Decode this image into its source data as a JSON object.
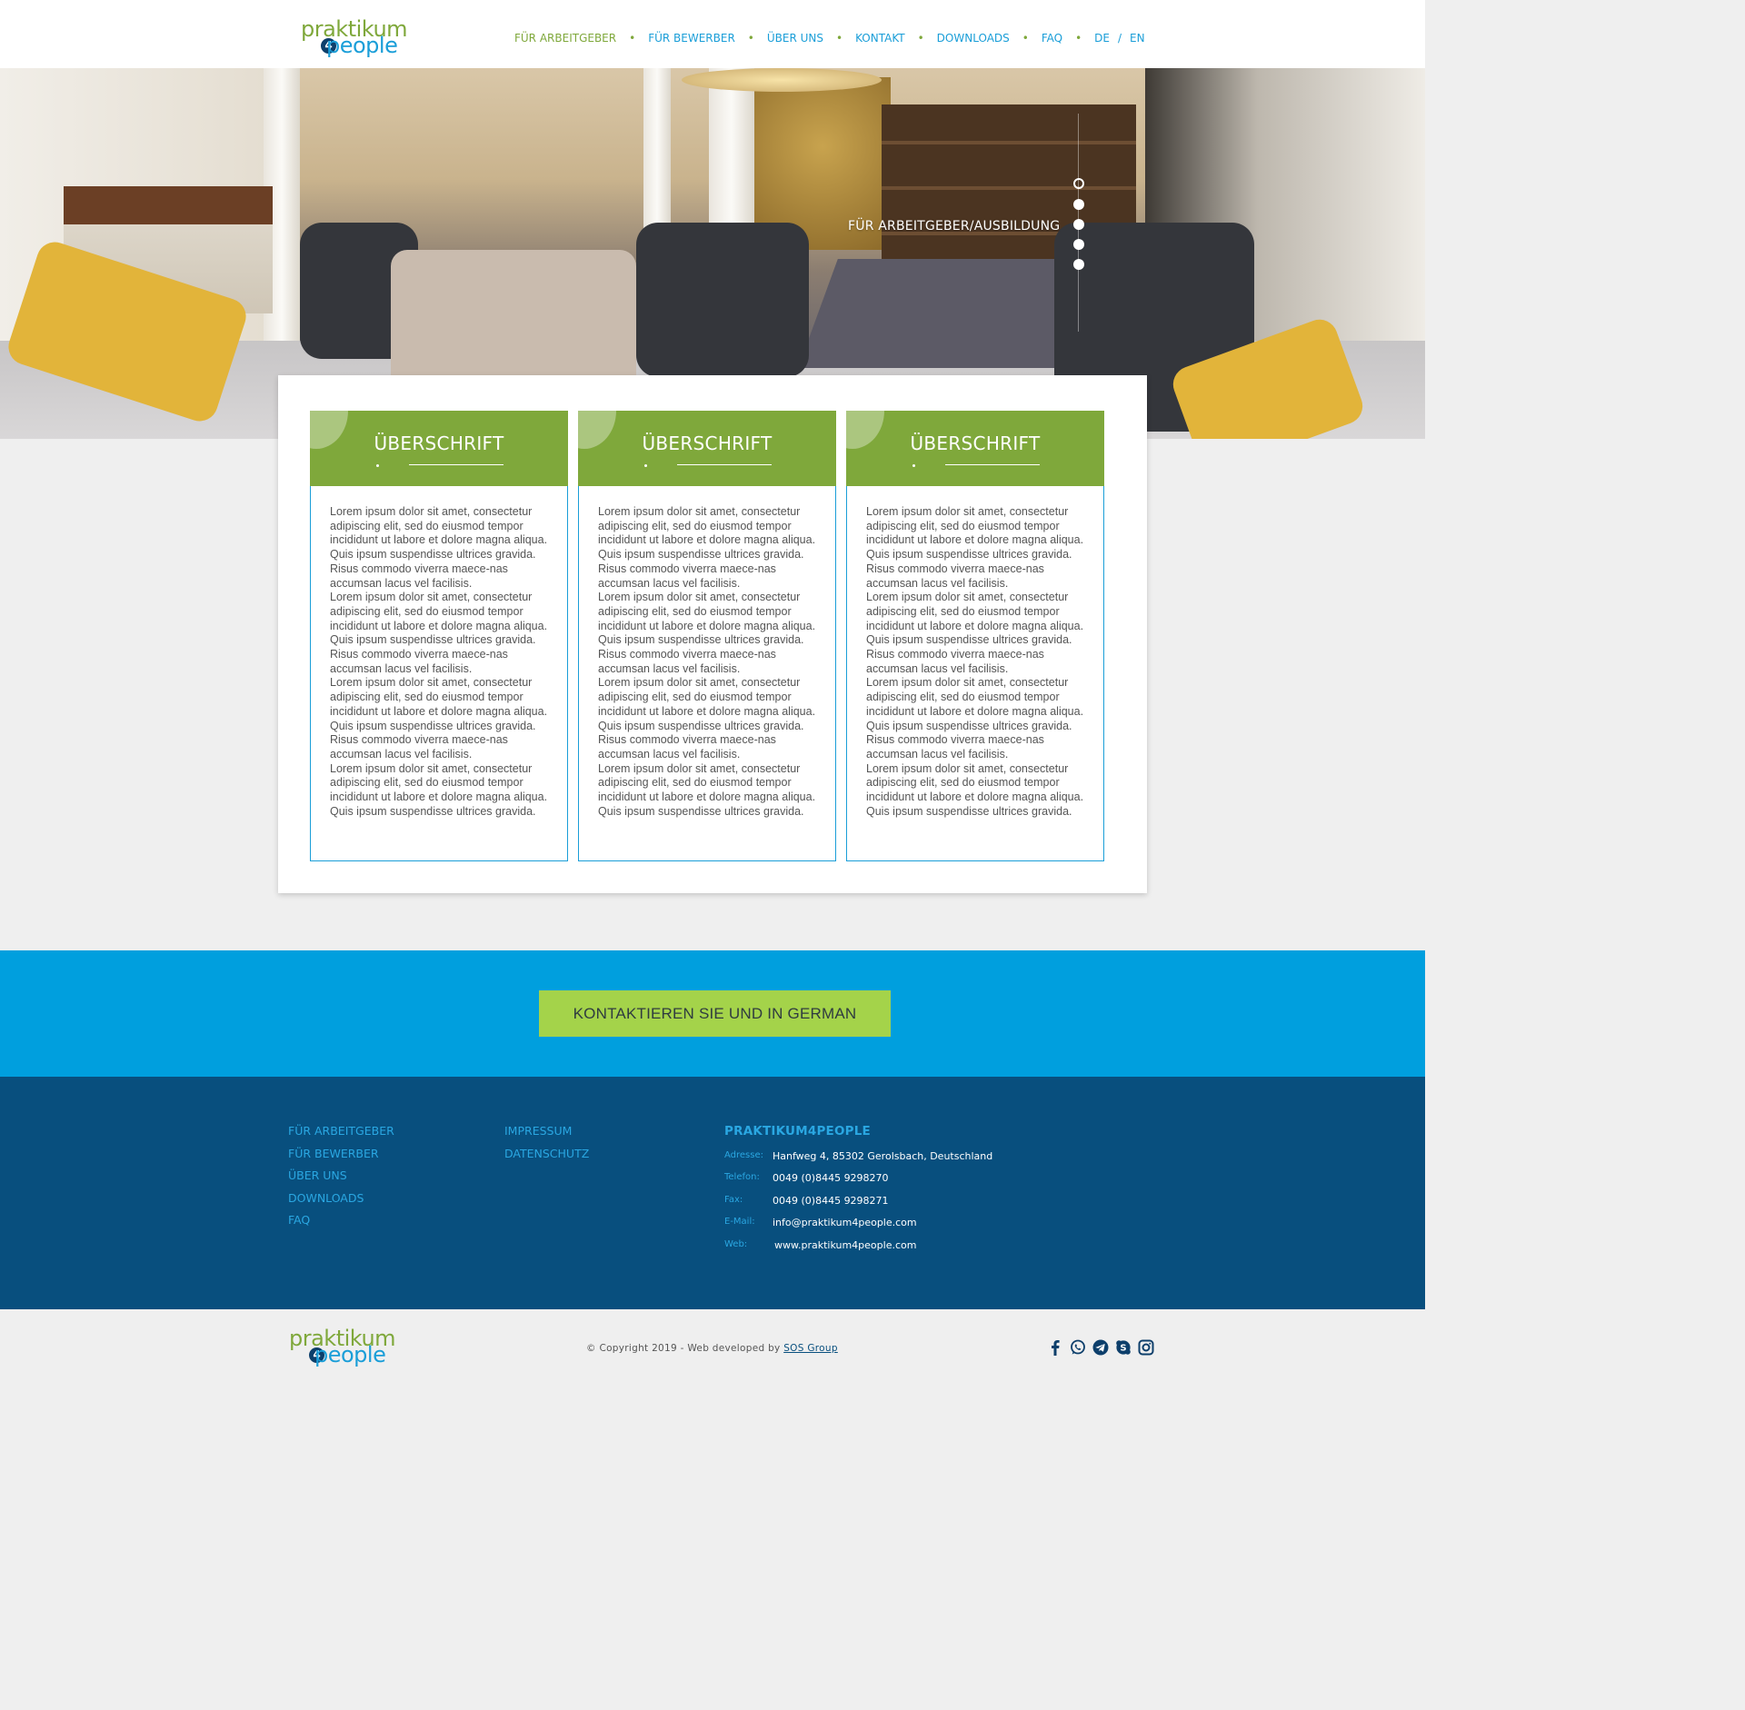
{
  "header": {
    "logo": {
      "top": "praktikum",
      "badge": "4",
      "bottom": "people"
    },
    "nav": [
      {
        "label": "FÜR ARBEITGEBER",
        "active": true
      },
      {
        "label": "FÜR BEWERBER",
        "active": false
      },
      {
        "label": "ÜBER UNS",
        "active": false
      },
      {
        "label": "KONTAKT",
        "active": false
      },
      {
        "label": "DOWNLOADS",
        "active": false
      },
      {
        "label": "FAQ",
        "active": false
      }
    ],
    "lang": {
      "de": "DE",
      "slash": "/",
      "en": "EN"
    }
  },
  "hero": {
    "title": "FÜR ARBEITGEBER/AUSBILDUNG",
    "slides_count": 5,
    "active_slide": 1
  },
  "boxes": [
    {
      "heading": "ÜBERSCHRIFT",
      "paragraphs": [
        "Lorem ipsum dolor sit amet, consectetur adipiscing elit, sed do eiusmod tempor incididunt ut labore et dolore magna aliqua. Quis ipsum suspendisse ultrices gravida. Risus commodo viverra maece-nas accumsan lacus vel facilisis.",
        "Lorem ipsum dolor sit amet, consectetur adipiscing elit, sed do eiusmod tempor incididunt ut labore et dolore magna aliqua. Quis ipsum suspendisse ultrices gravida. Risus commodo viverra maece-nas accumsan lacus vel facilisis.",
        "Lorem ipsum dolor sit amet, consectetur adipiscing elit, sed do eiusmod tempor incididunt ut labore et dolore magna aliqua. Quis ipsum suspendisse ultrices gravida. Risus commodo viverra maece-nas accumsan lacus vel facilisis.",
        "Lorem ipsum dolor sit amet, consectetur adipiscing elit, sed do eiusmod tempor incididunt ut labore et dolore magna aliqua. Quis ipsum suspendisse ultrices gravida."
      ]
    },
    {
      "heading": "ÜBERSCHRIFT",
      "paragraphs": [
        "Lorem ipsum dolor sit amet, consectetur adipiscing elit, sed do eiusmod tempor incididunt ut labore et dolore magna aliqua. Quis ipsum suspendisse ultrices gravida. Risus commodo viverra maece-nas accumsan lacus vel facilisis.",
        "Lorem ipsum dolor sit amet, consectetur adipiscing elit, sed do eiusmod tempor incididunt ut labore et dolore magna aliqua. Quis ipsum suspendisse ultrices gravida. Risus commodo viverra maece-nas accumsan lacus vel facilisis.",
        "Lorem ipsum dolor sit amet, consectetur adipiscing elit, sed do eiusmod tempor incididunt ut labore et dolore magna aliqua. Quis ipsum suspendisse ultrices gravida. Risus commodo viverra maece-nas accumsan lacus vel facilisis.",
        "Lorem ipsum dolor sit amet, consectetur adipiscing elit, sed do eiusmod tempor incididunt ut labore et dolore magna aliqua. Quis ipsum suspendisse ultrices gravida."
      ]
    },
    {
      "heading": "ÜBERSCHRIFT",
      "paragraphs": [
        "Lorem ipsum dolor sit amet, consectetur adipiscing elit, sed do eiusmod tempor incididunt ut labore et dolore magna aliqua. Quis ipsum suspendisse ultrices gravida. Risus commodo viverra maece-nas accumsan lacus vel facilisis.",
        "Lorem ipsum dolor sit amet, consectetur adipiscing elit, sed do eiusmod tempor incididunt ut labore et dolore magna aliqua. Quis ipsum suspendisse ultrices gravida. Risus commodo viverra maece-nas accumsan lacus vel facilisis.",
        "Lorem ipsum dolor sit amet, consectetur adipiscing elit, sed do eiusmod tempor incididunt ut labore et dolore magna aliqua. Quis ipsum suspendisse ultrices gravida. Risus commodo viverra maece-nas accumsan lacus vel facilisis.",
        "Lorem ipsum dolor sit amet, consectetur adipiscing elit, sed do eiusmod tempor incididunt ut labore et dolore magna aliqua. Quis ipsum suspendisse ultrices gravida."
      ]
    }
  ],
  "cta": {
    "label": "KONTAKTIEREN SIE UND IN GERMAN"
  },
  "footer": {
    "col1": [
      "FÜR ARBEITGEBER",
      "FÜR BEWERBER",
      "ÜBER UNS",
      "DOWNLOADS",
      "FAQ"
    ],
    "col2": [
      "IMPRESSUM",
      "DATENSCHUTZ"
    ],
    "contact": {
      "title": "PRAKTIKUM4PEOPLE",
      "rows": [
        {
          "key": "Adresse:",
          "value": "Hanfweg 4, 85302 Gerolsbach, Deutschland"
        },
        {
          "key": "Telefon:",
          "value": "0049 (0)8445 9298270"
        },
        {
          "key": "Fax:",
          "value": "0049 (0)8445 9298271"
        },
        {
          "key": "E-Mail:",
          "value": "info@praktikum4people.com"
        },
        {
          "key": "Web:",
          "value": "www.praktikum4people.com"
        }
      ]
    }
  },
  "bottom": {
    "copyright": "© Copyright 2019 - Web developed by",
    "developer": "SOS Group",
    "social": [
      "facebook-icon",
      "whatsapp-icon",
      "telegram-icon",
      "skype-icon",
      "instagram-icon"
    ]
  },
  "colors": {
    "green": "#7fa83b",
    "blue": "#1a9ed8",
    "navy": "#084f7e",
    "cta_band": "#009fde",
    "cta_button": "#a4d34a"
  }
}
